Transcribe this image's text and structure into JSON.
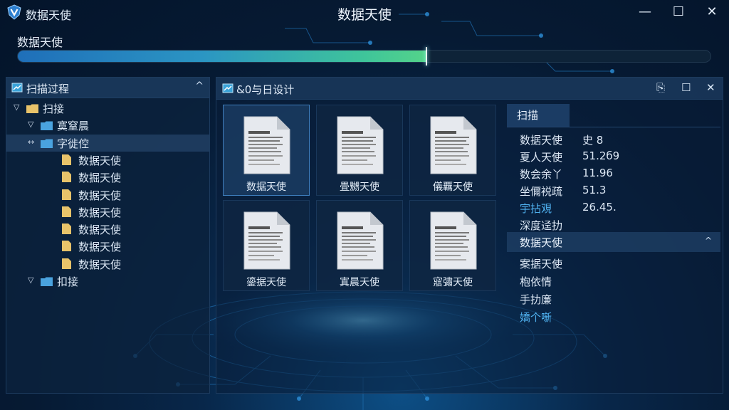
{
  "app": {
    "name": "数据天使",
    "window_title": "数据天使",
    "logo_icon": "shield-v-logo"
  },
  "window_controls": {
    "minimize": "—",
    "maximize": "☐",
    "close": "✕"
  },
  "progress": {
    "label": "数据天使",
    "value_percent": 59
  },
  "scan_panel": {
    "title": "扫描过程",
    "collapse_icon": "^",
    "tree": [
      {
        "label": "扫接",
        "level": 0,
        "type": "root"
      },
      {
        "label": "寞窒晨",
        "level": 1,
        "type": "folder"
      },
      {
        "label": "字徙倥",
        "level": 1,
        "type": "folder",
        "selected": true
      },
      {
        "label": "数据天使",
        "level": 2,
        "type": "file"
      },
      {
        "label": "数掘天使",
        "level": 2,
        "type": "file"
      },
      {
        "label": "数据天使",
        "level": 2,
        "type": "file"
      },
      {
        "label": "数据天使",
        "level": 2,
        "type": "file"
      },
      {
        "label": "数据天使",
        "level": 2,
        "type": "file"
      },
      {
        "label": "数据天使",
        "level": 2,
        "type": "file"
      },
      {
        "label": "数据天使",
        "level": 2,
        "type": "file"
      },
      {
        "label": "扣接",
        "level": 1,
        "type": "folder"
      }
    ]
  },
  "files_panel": {
    "title": "&0与日设计",
    "files": [
      {
        "name": "数据天使",
        "selected": true
      },
      {
        "name": "畳嬲天使"
      },
      {
        "name": "儀覊天使"
      },
      {
        "name": "鎏据天使"
      },
      {
        "name": "寘晨天使"
      },
      {
        "name": "寣彇天使"
      }
    ]
  },
  "properties": {
    "tab": "扫描",
    "rows": [
      {
        "key": "数据天使",
        "value": "史 8"
      },
      {
        "key": "夏人天使",
        "value": "51.2б9"
      },
      {
        "key": "数会余丫",
        "value": "11.96"
      },
      {
        "key": "坐儞裞疏",
        "value": "51.3"
      },
      {
        "key": "宇拈覌",
        "value": "26.45.",
        "highlight": true
      },
      {
        "key": "深度迳扐",
        "value": ""
      }
    ],
    "section": {
      "title": "数据天使",
      "items": [
        {
          "label": "案据天使"
        },
        {
          "label": "枹依情"
        },
        {
          "label": "手扐廉"
        },
        {
          "label": "嬌个噺",
          "link": true
        }
      ]
    }
  },
  "colors": {
    "accent": "#4fb0ee",
    "progress_start": "#1f6fb9",
    "progress_end": "#54d38a",
    "folder_blue": "#4aa3df",
    "folder_yellow": "#e8c36a",
    "background": "#061a33"
  }
}
